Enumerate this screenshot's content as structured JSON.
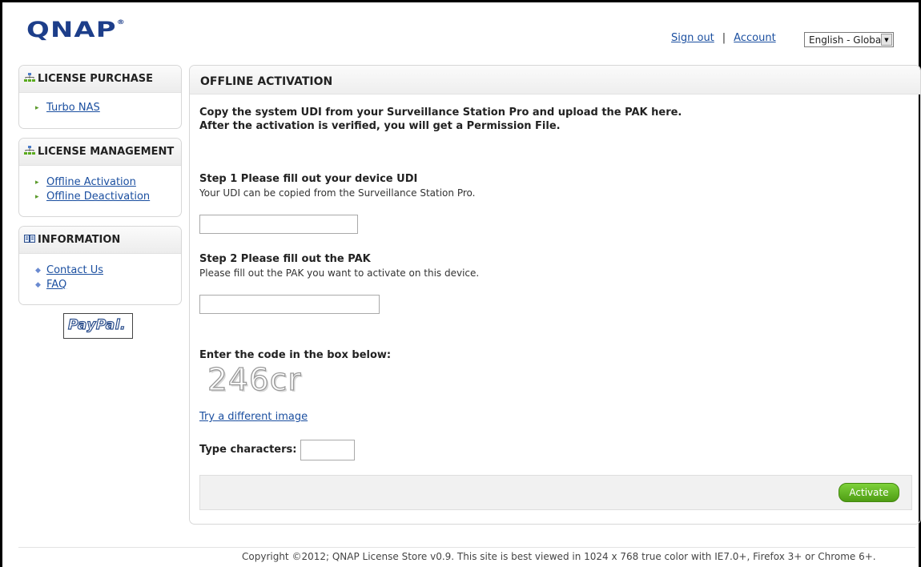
{
  "header": {
    "logo": "QNAP",
    "logo_mark": "®",
    "sign_out": "Sign out",
    "separator": "|",
    "account": "Account",
    "language": "English - Global"
  },
  "sidebar": {
    "license_purchase": {
      "title": "LICENSE PURCHASE",
      "items": [
        {
          "label": "Turbo NAS"
        }
      ]
    },
    "license_management": {
      "title": "LICENSE MANAGEMENT",
      "items": [
        {
          "label": "Offline Activation"
        },
        {
          "label": "Offline Deactivation"
        }
      ]
    },
    "information": {
      "title": "INFORMATION",
      "items": [
        {
          "label": "Contact Us"
        },
        {
          "label": "FAQ"
        }
      ]
    },
    "paypal": "PayPal."
  },
  "main": {
    "title": "OFFLINE ACTIVATION",
    "intro_line1": "Copy the system UDI from your Surveillance Station Pro and upload the PAK here.",
    "intro_line2": "After the activation is verified, you will get a Permission File.",
    "step1_title": "Step 1 Please fill out your device UDI",
    "step1_desc": "Your UDI can be copied from the Surveillance Station Pro.",
    "step1_value": "",
    "step2_title": "Step 2 Please fill out the PAK",
    "step2_desc": "Please fill out the PAK you want to activate on this device.",
    "step2_value": "",
    "captcha_prompt": "Enter the code in the box below:",
    "captcha_text": "246cr",
    "try_link": "Try a different image",
    "type_label": "Type characters:",
    "type_value": "",
    "activate_label": "Activate"
  },
  "footer": {
    "text": "Copyright ©2012; QNAP License Store v0.9. This site is best viewed in 1024 x 768 true color with IE7.0+, Firefox 3+ or Chrome 6+."
  },
  "colors": {
    "link": "#1b4fa0",
    "logo": "#1d3e8a",
    "activate": "#5aab1e"
  }
}
